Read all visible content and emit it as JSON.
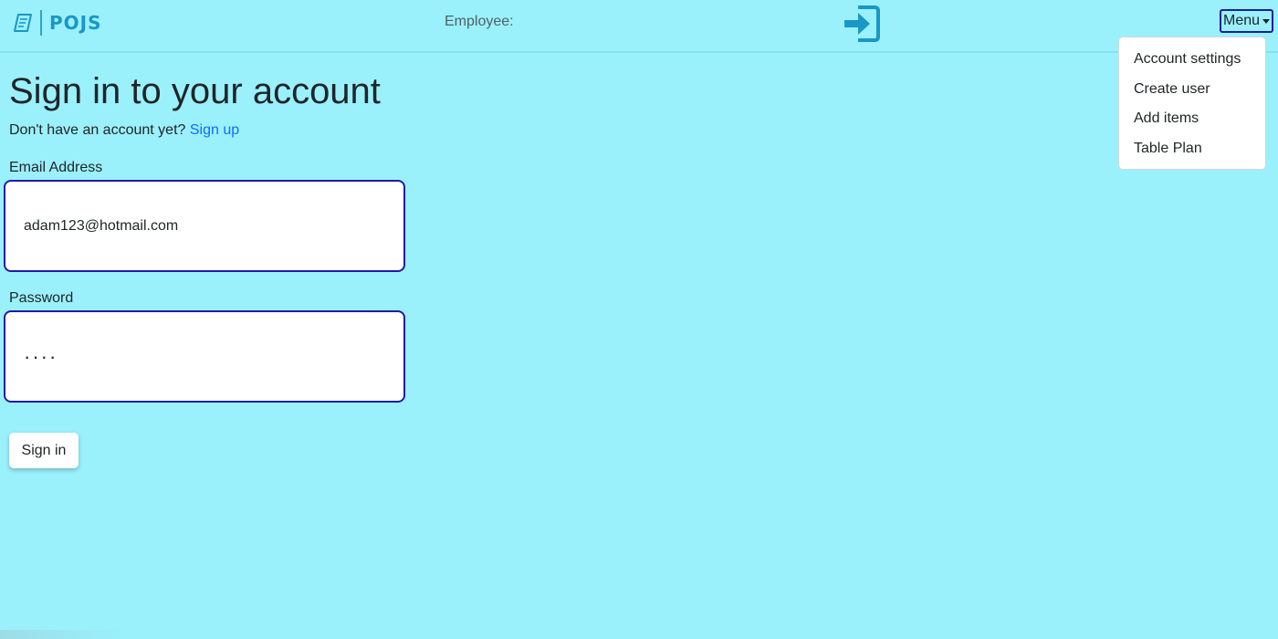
{
  "navbar": {
    "brand_text": "POJS",
    "brand_icon": "receipt-logo-icon",
    "employee_label": "Employee:",
    "signin_icon": "sign-in-icon",
    "menu_label": "Menu",
    "menu_items": [
      {
        "label": "Account settings"
      },
      {
        "label": "Create user"
      },
      {
        "label": "Add items"
      },
      {
        "label": "Table Plan"
      }
    ]
  },
  "main": {
    "title": "Sign in to your account",
    "signup_prompt": "Don't have an account yet?",
    "signup_link": "Sign up",
    "email": {
      "label": "Email Address",
      "value": "adam123@hotmail.com"
    },
    "password": {
      "label": "Password",
      "value": "····"
    },
    "signin_button": "Sign in"
  },
  "colors": {
    "background": "#9af1fc",
    "accent": "#1a97c7",
    "link": "#0d6efd",
    "input_border": "#2318a8"
  }
}
